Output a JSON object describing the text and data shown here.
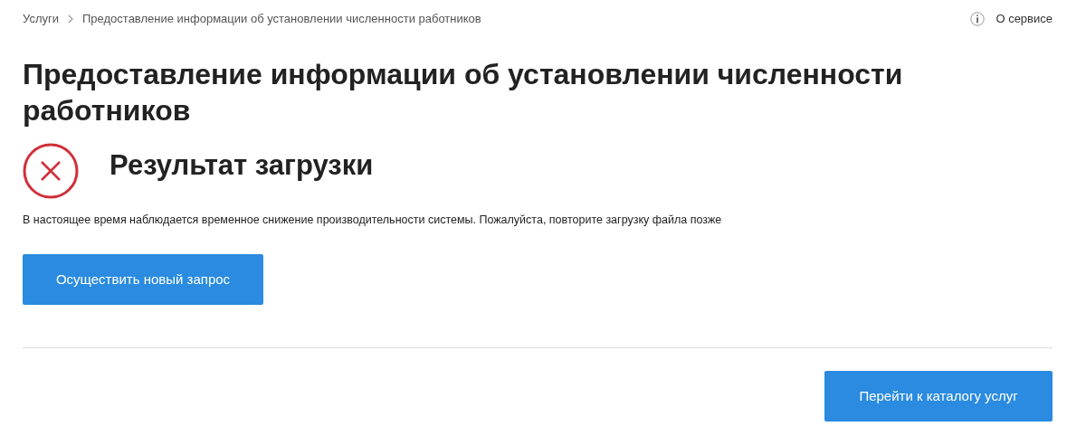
{
  "breadcrumbs": [
    {
      "label": "Услуги"
    },
    {
      "label": "Предоставление информации об установлении численности работников"
    }
  ],
  "about_link": {
    "label": "О сервисе"
  },
  "title": "Предоставление информации об установлении численности работников",
  "result": {
    "kind": "error",
    "heading": "Результат загрузки",
    "message": "В настоящее время наблюдается временное снижение производительности системы. Пожалуйста, повторите загрузку файла позже"
  },
  "primary_button": "Осуществить новый запрос",
  "catalog_button": "Перейти к каталогу услуг"
}
